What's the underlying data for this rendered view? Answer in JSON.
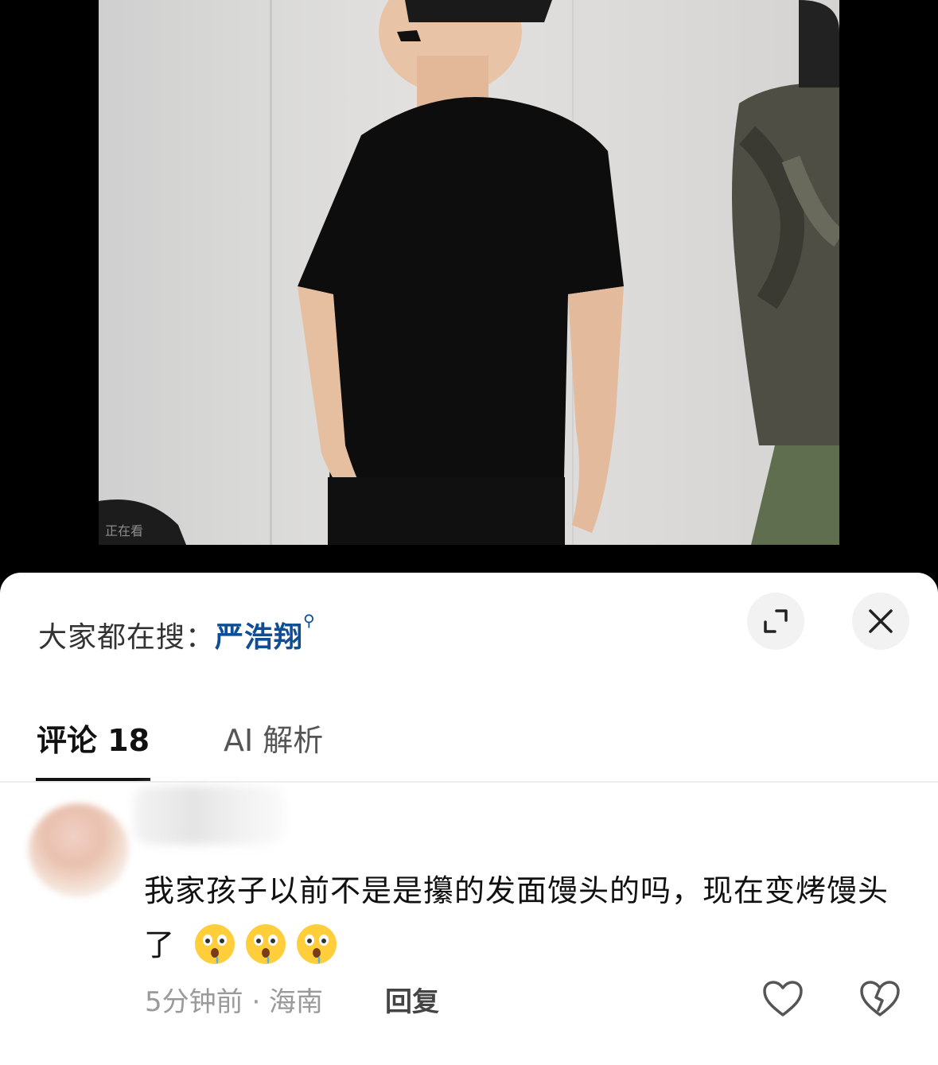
{
  "video": {
    "watching_text": "正在看"
  },
  "sheet": {
    "search_hint_prefix": "大家都在搜：",
    "search_keyword": "严浩翔",
    "search_icon": "magnifier-icon",
    "expand_icon": "expand-icon",
    "close_icon": "close-icon"
  },
  "tabs": [
    {
      "label": "评论 18",
      "active": true
    },
    {
      "label": "AI 解析",
      "active": false
    }
  ],
  "comment": {
    "text": "我家孩子以前不是是攥的发面馒头的吗，现在变烤馒头了",
    "emojis": [
      "drooling-face-emoji",
      "drooling-face-emoji",
      "drooling-face-emoji"
    ],
    "meta": "5分钟前 · 海南",
    "reply_label": "回复",
    "like_icon": "heart-icon",
    "dislike_icon": "broken-heart-icon"
  },
  "colors": {
    "keyword": "#0f4e94",
    "sheet_bg": "#ffffff",
    "video_bg": "#000000"
  }
}
